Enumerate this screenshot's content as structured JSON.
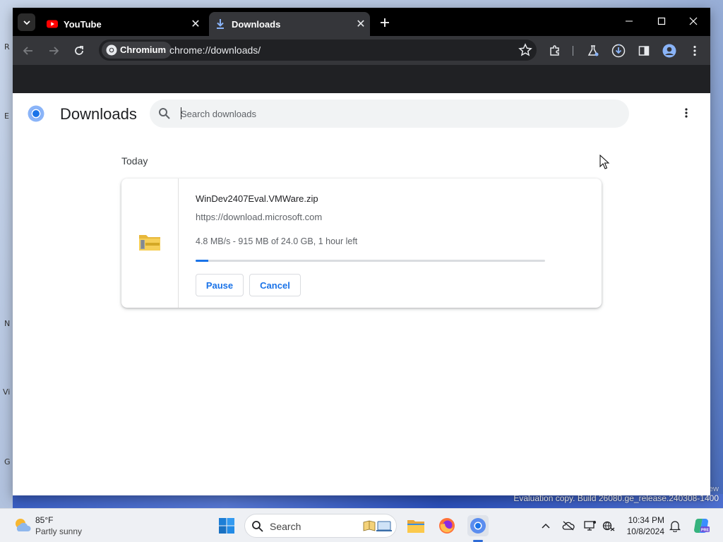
{
  "browser": {
    "tabs": [
      {
        "title": "YouTube",
        "active": false
      },
      {
        "title": "Downloads",
        "active": true
      }
    ],
    "omnibox": {
      "chip_label": "Chromium",
      "url": "chrome://downloads/"
    }
  },
  "page": {
    "title": "Downloads",
    "search_placeholder": "Search downloads",
    "date_group": "Today",
    "downloads": [
      {
        "file_name": "WinDev2407Eval.VMWare.zip",
        "source_url": "https://download.microsoft.com",
        "status": "4.8 MB/s - 915 MB of 24.0 GB, 1 hour left",
        "progress_fraction": 0.037,
        "pause_label": "Pause",
        "cancel_label": "Cancel"
      }
    ]
  },
  "desktop": {
    "edge_glyphs": [
      "R",
      "E",
      "N",
      "Vi",
      "G"
    ],
    "watermark_tail": "ew",
    "evaluation_text": "Evaluation copy. Build 26080.ge_release.240308-1400"
  },
  "taskbar": {
    "weather_temp": "85°F",
    "weather_condition": "Partly sunny",
    "search_label": "Search",
    "time": "10:34 PM",
    "date": "10/8/2024",
    "copilot_badge": "PRE"
  },
  "colors": {
    "accent": "#1a73e8",
    "tabstrip": "#000000",
    "toolbar": "#35363a"
  }
}
